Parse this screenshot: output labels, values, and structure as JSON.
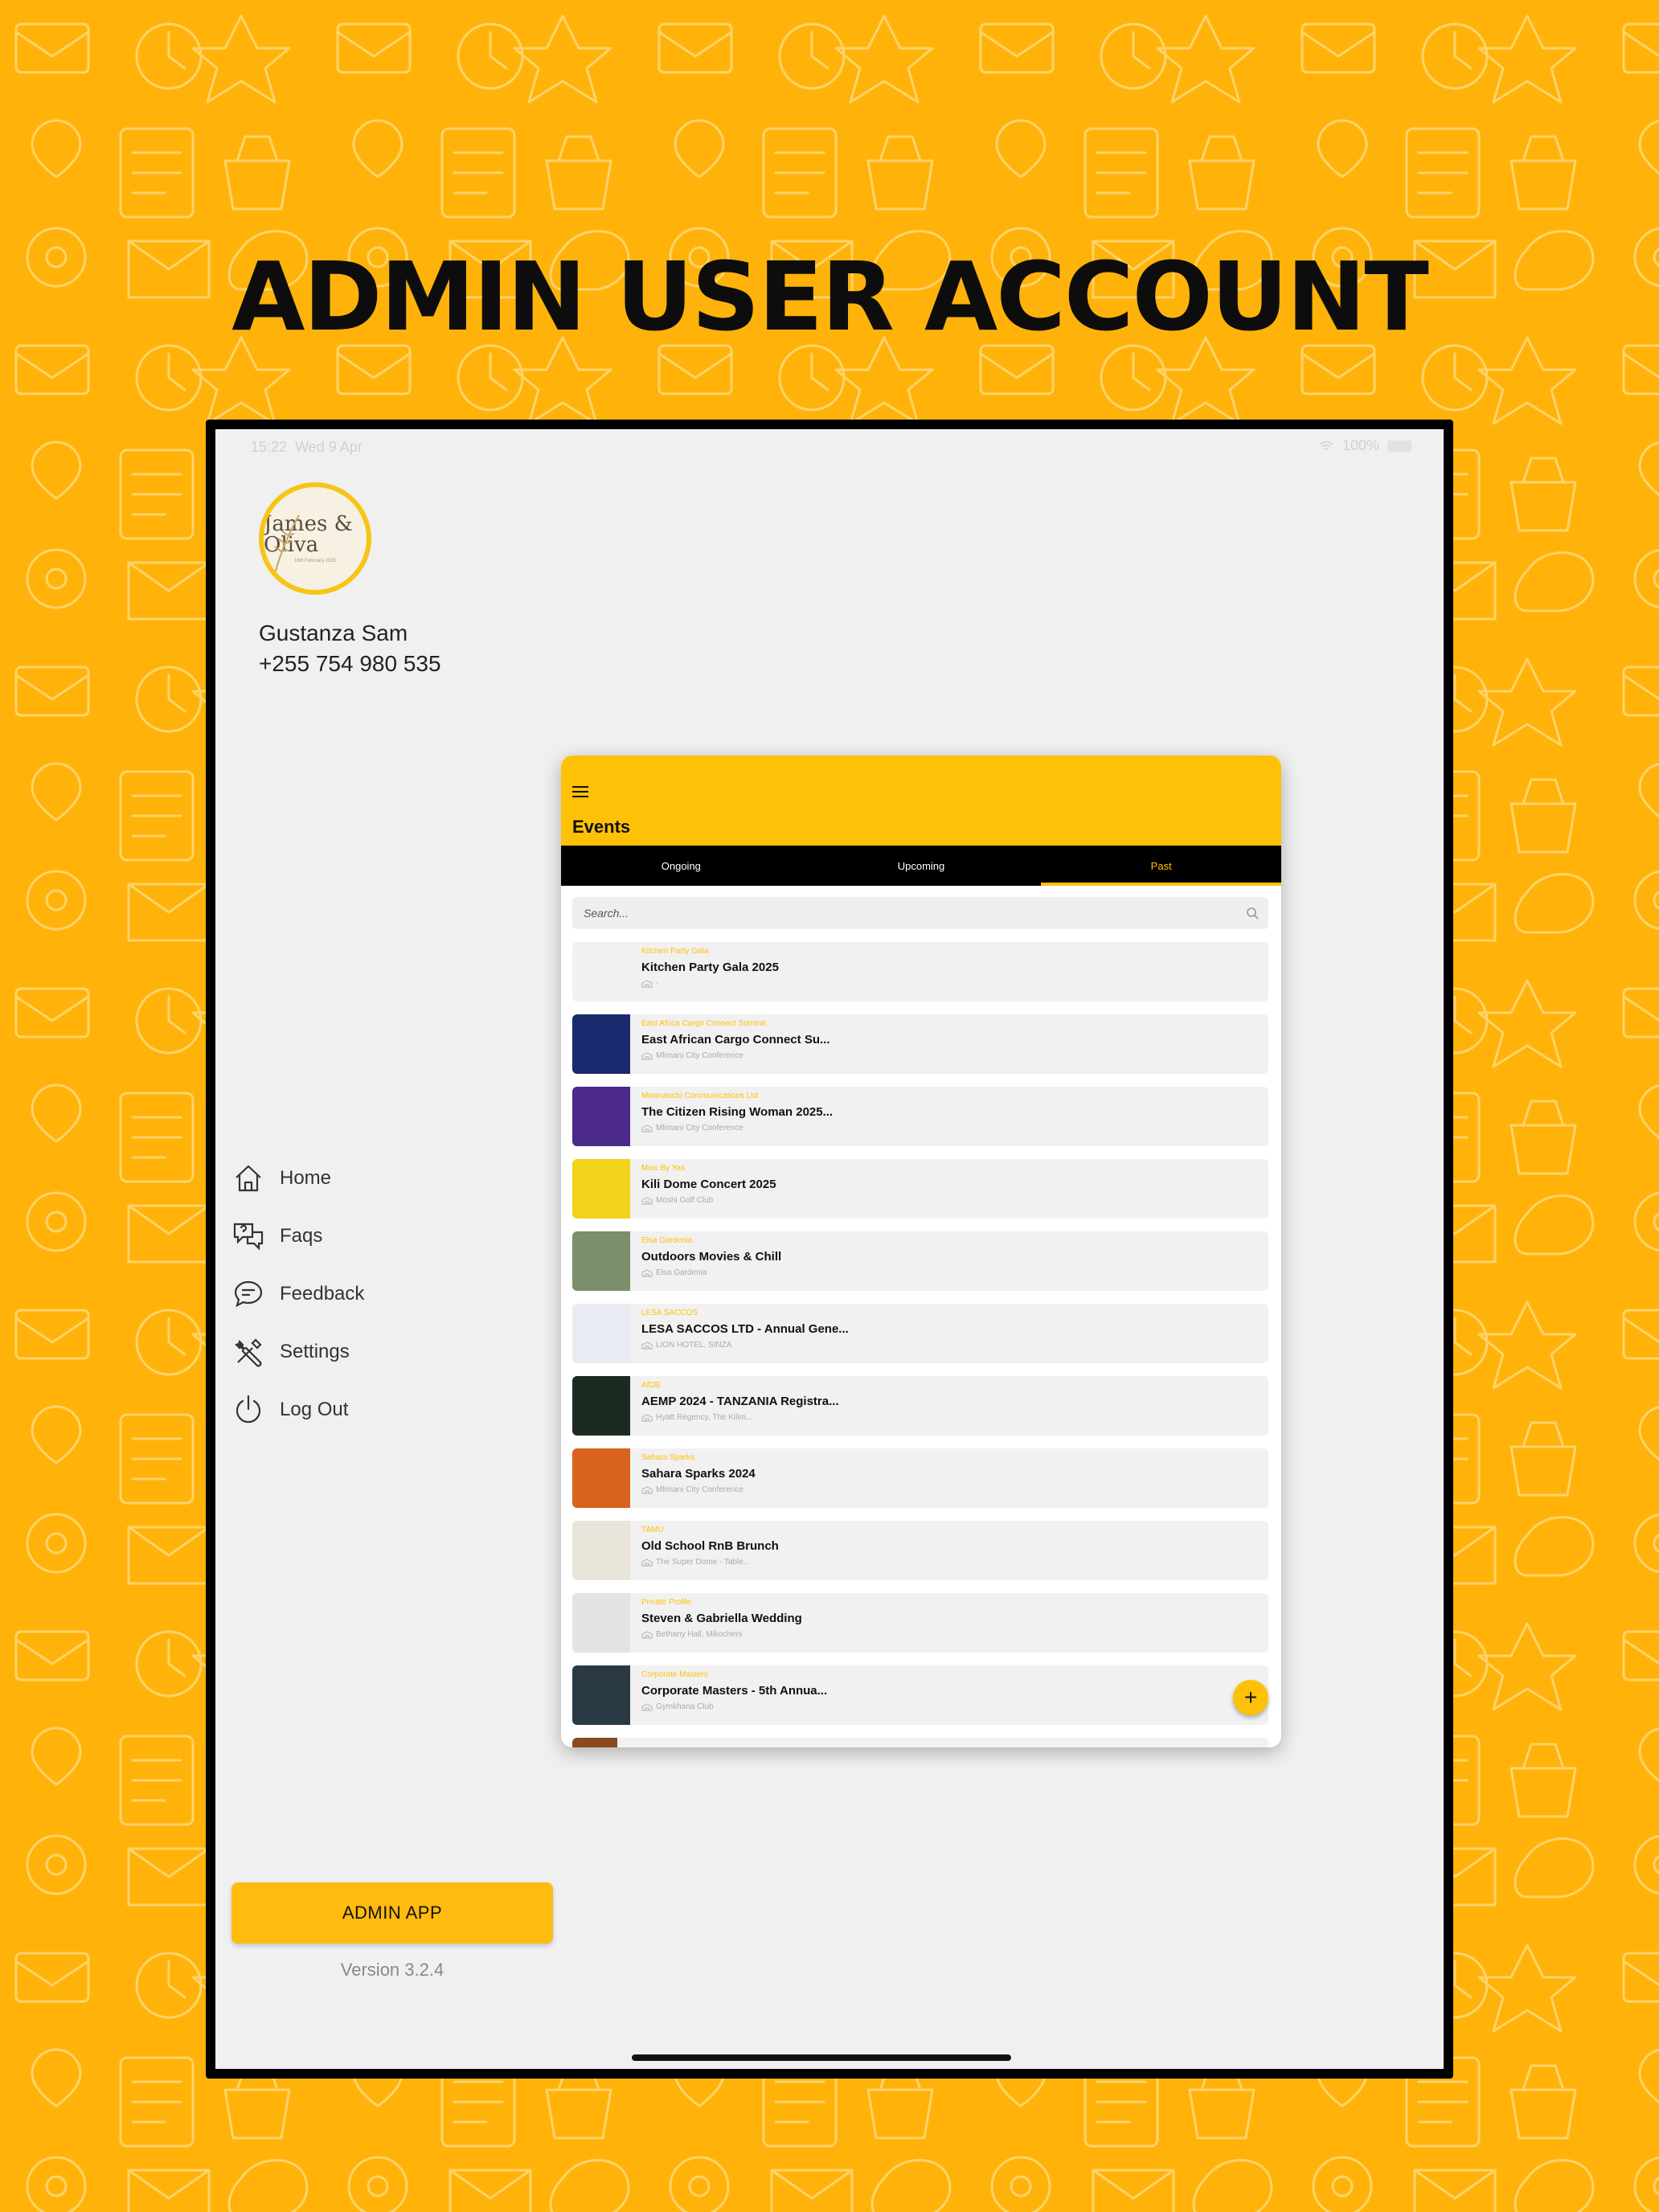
{
  "headline": "ADMIN USER ACCOUNT",
  "status_bar": {
    "time": "15:22",
    "date": "Wed 9 Apr",
    "battery": "100%"
  },
  "profile": {
    "avatar_text": "James & Oliva",
    "avatar_date": "16th February 2025",
    "name": "Gustanza Sam",
    "phone": "+255 754 980 535"
  },
  "menu": [
    {
      "label": "Home",
      "icon": "home-icon"
    },
    {
      "label": "Faqs",
      "icon": "faq-chat-icon"
    },
    {
      "label": "Feedback",
      "icon": "feedback-icon"
    },
    {
      "label": "Settings",
      "icon": "settings-tools-icon"
    },
    {
      "label": "Log Out",
      "icon": "power-icon"
    }
  ],
  "admin_button": "ADMIN APP",
  "version": "Version 3.2.4",
  "app": {
    "title": "Events",
    "tabs": [
      "Ongoing",
      "Upcoming",
      "Past"
    ],
    "active_tab": "Past",
    "search_placeholder": "Search...",
    "events": [
      {
        "category": "Kitchen Party Gala",
        "title": "Kitchen Party Gala 2025",
        "location": "-",
        "thumb": "#f1f1f1"
      },
      {
        "category": "East Africa Cargo Connect Summit",
        "title": "East African Cargo Connect Su...",
        "location": "Mlimani City Conference",
        "thumb": "#1a2a6e"
      },
      {
        "category": "Mwananchi Communications Ltd",
        "title": "The Citizen Rising Woman 2025...",
        "location": "Mlimani City Conference",
        "thumb": "#4b2a8a"
      },
      {
        "category": "Mixx By Yas",
        "title": "Kili Dome Concert 2025",
        "location": "Moshi Golf Club",
        "thumb": "#f2d21a"
      },
      {
        "category": "Elsa Gardenia",
        "title": "Outdoors Movies & Chill",
        "location": "Elsa Gardenia",
        "thumb": "#7a8f6a"
      },
      {
        "category": "LESA SACCOS",
        "title": "LESA SACCOS LTD - Annual Gene...",
        "location": "LION HOTEL, SINZA",
        "thumb": "#e8ecf2"
      },
      {
        "category": "AfDB",
        "title": "AEMP 2024 - TANZANIA Registra...",
        "location": "Hyatt Regency, The Kilim...",
        "thumb": "#1c2a22"
      },
      {
        "category": "Sahara Sparks",
        "title": "Sahara Sparks 2024",
        "location": "Mlimani City Conference",
        "thumb": "#d8621e"
      },
      {
        "category": "TAMU",
        "title": "Old School RnB Brunch",
        "location": "The Super Dome - Table...",
        "thumb": "#e9e5da"
      },
      {
        "category": "Private Profile",
        "title": "Steven & Gabriella Wedding",
        "location": "Bethany Hall, Mikocheni",
        "thumb": "#e3e3e3"
      },
      {
        "category": "Corporate Masters",
        "title": "Corporate Masters - 5th Annua...",
        "location": "Gymkhana Club",
        "thumb": "#2a3a44"
      }
    ],
    "fab": "+"
  },
  "colors": {
    "background": "#FFB30A",
    "accent": "#FFC107",
    "tab_bar": "#000000"
  }
}
